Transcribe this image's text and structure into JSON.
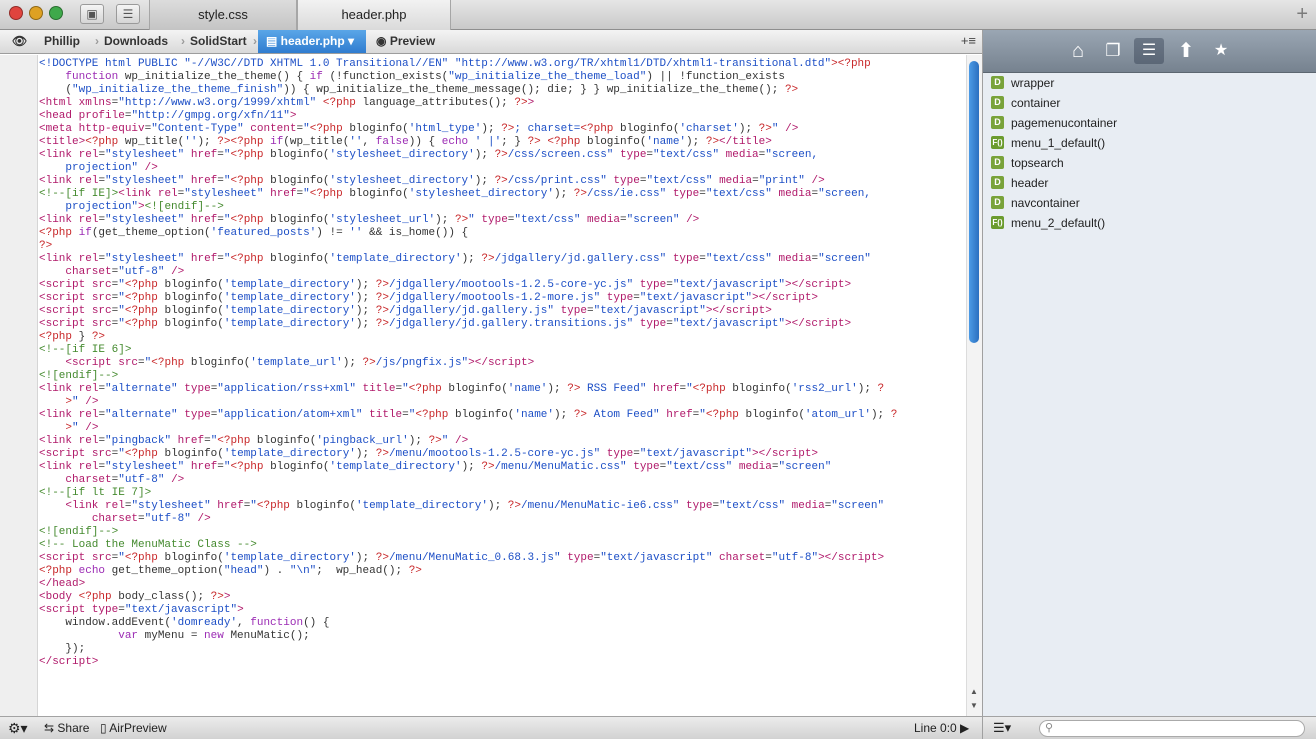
{
  "window": {
    "tabs": [
      {
        "label": "style.css",
        "active": false
      },
      {
        "label": "header.php",
        "active": true
      }
    ],
    "add_tab_label": "+"
  },
  "pathbar": {
    "breadcrumb": [
      "Phillip",
      "Downloads",
      "SolidStart",
      "header.php ▾"
    ],
    "preview_label": "Preview",
    "sidebar_toggle_label": "+≡"
  },
  "editor": {
    "lines": [
      {
        "n": "1",
        "html": "<span class=\"s\">&lt;!DOCTYPE html PUBLIC \"-//W3C//DTD XHTML 1.0 Transitional//EN\" \"http://www.w3.org/TR/xhtml1/DTD/xhtml1-transitional.dtd\"</span><span class=\"p\">&gt;&lt;?php</span>"
      },
      {
        "n": "",
        "html": "    <span class=\"k\">function</span> wp_initialize_the_theme() { <span class=\"k\">if</span> (!function_exists(<span class=\"s\">\"wp_initialize_the_theme_load\"</span>) || !function_exists"
      },
      {
        "n": "",
        "html": "    (<span class=\"s\">\"wp_initialize_the_theme_finish\"</span>)) { wp_initialize_the_theme_message(); die; } } wp_initialize_the_theme(); <span class=\"p\">?&gt;</span>"
      },
      {
        "n": "2",
        "html": "<span class=\"t\">&lt;html</span> <span class=\"a\">xmlns</span>=<span class=\"s\">\"http://www.w3.org/1999/xhtml\"</span> <span class=\"p\">&lt;?php</span> language_attributes(); <span class=\"p\">?&gt;</span><span class=\"t\">&gt;</span>"
      },
      {
        "n": "3",
        "html": ""
      },
      {
        "n": "4",
        "html": "<span class=\"t\">&lt;head</span> <span class=\"a\">profile</span>=<span class=\"s\">\"http://gmpg.org/xfn/11\"</span><span class=\"t\">&gt;</span>"
      },
      {
        "n": "5",
        "html": "<span class=\"t\">&lt;meta</span> <span class=\"a\">http-equiv</span>=<span class=\"s\">\"Content-Type\"</span> <span class=\"a\">content</span>=<span class=\"s\">\"</span><span class=\"p\">&lt;?php</span> bloginfo(<span class=\"s\">'html_type'</span>); <span class=\"p\">?&gt;</span><span class=\"s\">; charset=</span><span class=\"p\">&lt;?php</span> bloginfo(<span class=\"s\">'charset'</span>); <span class=\"p\">?&gt;</span><span class=\"s\">\"</span> <span class=\"t\">/&gt;</span>"
      },
      {
        "n": "6",
        "html": ""
      },
      {
        "n": "7",
        "html": "<span class=\"t\">&lt;title&gt;</span><span class=\"p\">&lt;?php</span> wp_title(<span class=\"s\">''</span>); <span class=\"p\">?&gt;&lt;?php</span> <span class=\"k\">if</span>(wp_title(<span class=\"s\">''</span>, <span class=\"k\">false</span>)) { <span class=\"k\">echo</span> <span class=\"s\">' |'</span>; } <span class=\"p\">?&gt;</span> <span class=\"p\">&lt;?php</span> bloginfo(<span class=\"s\">'name'</span>); <span class=\"p\">?&gt;</span><span class=\"t\">&lt;/title&gt;</span>"
      },
      {
        "n": "8",
        "html": "<span class=\"t\">&lt;link</span> <span class=\"a\">rel</span>=<span class=\"s\">\"stylesheet\"</span> <span class=\"a\">href</span>=<span class=\"s\">\"</span><span class=\"p\">&lt;?php</span> bloginfo(<span class=\"s\">'stylesheet_directory'</span>); <span class=\"p\">?&gt;</span><span class=\"s\">/css/screen.css\"</span> <span class=\"a\">type</span>=<span class=\"s\">\"text/css\"</span> <span class=\"a\">media</span>=<span class=\"s\">\"screen,</span>"
      },
      {
        "n": "",
        "html": "    <span class=\"s\">projection\"</span> <span class=\"t\">/&gt;</span>"
      },
      {
        "n": "9",
        "html": "<span class=\"t\">&lt;link</span> <span class=\"a\">rel</span>=<span class=\"s\">\"stylesheet\"</span> <span class=\"a\">href</span>=<span class=\"s\">\"</span><span class=\"p\">&lt;?php</span> bloginfo(<span class=\"s\">'stylesheet_directory'</span>); <span class=\"p\">?&gt;</span><span class=\"s\">/css/print.css\"</span> <span class=\"a\">type</span>=<span class=\"s\">\"text/css\"</span> <span class=\"a\">media</span>=<span class=\"s\">\"print\"</span> <span class=\"t\">/&gt;</span>"
      },
      {
        "n": "10",
        "html": "<span class=\"c\">&lt;!--[if IE]&gt;</span><span class=\"t\">&lt;link</span> <span class=\"a\">rel</span>=<span class=\"s\">\"stylesheet\"</span> <span class=\"a\">href</span>=<span class=\"s\">\"</span><span class=\"p\">&lt;?php</span> bloginfo(<span class=\"s\">'stylesheet_directory'</span>); <span class=\"p\">?&gt;</span><span class=\"s\">/css/ie.css\"</span> <span class=\"a\">type</span>=<span class=\"s\">\"text/css\"</span> <span class=\"a\">media</span>=<span class=\"s\">\"screen,</span>"
      },
      {
        "n": "",
        "html": "    <span class=\"s\">projection\"</span><span class=\"t\">&gt;</span><span class=\"c\">&lt;![endif]--&gt;</span>"
      },
      {
        "n": "11",
        "html": "<span class=\"t\">&lt;link</span> <span class=\"a\">rel</span>=<span class=\"s\">\"stylesheet\"</span> <span class=\"a\">href</span>=<span class=\"s\">\"</span><span class=\"p\">&lt;?php</span> bloginfo(<span class=\"s\">'stylesheet_url'</span>); <span class=\"p\">?&gt;</span><span class=\"s\">\"</span> <span class=\"a\">type</span>=<span class=\"s\">\"text/css\"</span> <span class=\"a\">media</span>=<span class=\"s\">\"screen\"</span> <span class=\"t\">/&gt;</span>"
      },
      {
        "n": "12",
        "html": "<span class=\"p\">&lt;?php</span> <span class=\"k\">if</span>(get_theme_option(<span class=\"s\">'featured_posts'</span>) != <span class=\"s\">''</span> &amp;&amp; is_home()) {"
      },
      {
        "n": "13",
        "html": "<span class=\"p\">?&gt;</span>"
      },
      {
        "n": "14",
        "html": "<span class=\"t\">&lt;link</span> <span class=\"a\">rel</span>=<span class=\"s\">\"stylesheet\"</span> <span class=\"a\">href</span>=<span class=\"s\">\"</span><span class=\"p\">&lt;?php</span> bloginfo(<span class=\"s\">'template_directory'</span>); <span class=\"p\">?&gt;</span><span class=\"s\">/jdgallery/jd.gallery.css\"</span> <span class=\"a\">type</span>=<span class=\"s\">\"text/css\"</span> <span class=\"a\">media</span>=<span class=\"s\">\"screen\"</span>"
      },
      {
        "n": "",
        "html": "    <span class=\"a\">charset</span>=<span class=\"s\">\"utf-8\"</span> <span class=\"t\">/&gt;</span>"
      },
      {
        "n": "15",
        "html": "<span class=\"t\">&lt;script</span> <span class=\"a\">src</span>=<span class=\"s\">\"</span><span class=\"p\">&lt;?php</span> bloginfo(<span class=\"s\">'template_directory'</span>); <span class=\"p\">?&gt;</span><span class=\"s\">/jdgallery/mootools-1.2.5-core-yc.js\"</span> <span class=\"a\">type</span>=<span class=\"s\">\"text/javascript\"</span><span class=\"t\">&gt;&lt;/script&gt;</span>"
      },
      {
        "n": "16",
        "html": "<span class=\"t\">&lt;script</span> <span class=\"a\">src</span>=<span class=\"s\">\"</span><span class=\"p\">&lt;?php</span> bloginfo(<span class=\"s\">'template_directory'</span>); <span class=\"p\">?&gt;</span><span class=\"s\">/jdgallery/mootools-1.2-more.js\"</span> <span class=\"a\">type</span>=<span class=\"s\">\"text/javascript\"</span><span class=\"t\">&gt;&lt;/script&gt;</span>"
      },
      {
        "n": "17",
        "html": "<span class=\"t\">&lt;script</span> <span class=\"a\">src</span>=<span class=\"s\">\"</span><span class=\"p\">&lt;?php</span> bloginfo(<span class=\"s\">'template_directory'</span>); <span class=\"p\">?&gt;</span><span class=\"s\">/jdgallery/jd.gallery.js\"</span> <span class=\"a\">type</span>=<span class=\"s\">\"text/javascript\"</span><span class=\"t\">&gt;&lt;/script&gt;</span>"
      },
      {
        "n": "18",
        "html": "<span class=\"t\">&lt;script</span> <span class=\"a\">src</span>=<span class=\"s\">\"</span><span class=\"p\">&lt;?php</span> bloginfo(<span class=\"s\">'template_directory'</span>); <span class=\"p\">?&gt;</span><span class=\"s\">/jdgallery/jd.gallery.transitions.js\"</span> <span class=\"a\">type</span>=<span class=\"s\">\"text/javascript\"</span><span class=\"t\">&gt;&lt;/script&gt;</span>"
      },
      {
        "n": "19",
        "html": "<span class=\"p\">&lt;?php</span> } <span class=\"p\">?&gt;</span>"
      },
      {
        "n": "20",
        "html": "<span class=\"c\">&lt;!--[if IE 6]&gt;</span>"
      },
      {
        "n": "21",
        "html": "    <span class=\"t\">&lt;script</span> <span class=\"a\">src</span>=<span class=\"s\">\"</span><span class=\"p\">&lt;?php</span> bloginfo(<span class=\"s\">'template_url'</span>); <span class=\"p\">?&gt;</span><span class=\"s\">/js/pngfix.js\"</span><span class=\"t\">&gt;&lt;/script&gt;</span>"
      },
      {
        "n": "22",
        "html": "<span class=\"c\">&lt;![endif]--&gt;</span>"
      },
      {
        "n": "23",
        "html": "<span class=\"t\">&lt;link</span> <span class=\"a\">rel</span>=<span class=\"s\">\"alternate\"</span> <span class=\"a\">type</span>=<span class=\"s\">\"application/rss+xml\"</span> <span class=\"a\">title</span>=<span class=\"s\">\"</span><span class=\"p\">&lt;?php</span> bloginfo(<span class=\"s\">'name'</span>); <span class=\"p\">?&gt;</span><span class=\"s\"> RSS Feed\"</span> <span class=\"a\">href</span>=<span class=\"s\">\"</span><span class=\"p\">&lt;?php</span> bloginfo(<span class=\"s\">'rss2_url'</span>); <span class=\"p\">?</span>"
      },
      {
        "n": "",
        "html": "    <span class=\"p\">&gt;</span><span class=\"s\">\"</span> <span class=\"t\">/&gt;</span>"
      },
      {
        "n": "24",
        "html": "<span class=\"t\">&lt;link</span> <span class=\"a\">rel</span>=<span class=\"s\">\"alternate\"</span> <span class=\"a\">type</span>=<span class=\"s\">\"application/atom+xml\"</span> <span class=\"a\">title</span>=<span class=\"s\">\"</span><span class=\"p\">&lt;?php</span> bloginfo(<span class=\"s\">'name'</span>); <span class=\"p\">?&gt;</span><span class=\"s\"> Atom Feed\"</span> <span class=\"a\">href</span>=<span class=\"s\">\"</span><span class=\"p\">&lt;?php</span> bloginfo(<span class=\"s\">'atom_url'</span>); <span class=\"p\">?</span>"
      },
      {
        "n": "",
        "html": "    <span class=\"p\">&gt;</span><span class=\"s\">\"</span> <span class=\"t\">/&gt;</span>"
      },
      {
        "n": "25",
        "html": "<span class=\"t\">&lt;link</span> <span class=\"a\">rel</span>=<span class=\"s\">\"pingback\"</span> <span class=\"a\">href</span>=<span class=\"s\">\"</span><span class=\"p\">&lt;?php</span> bloginfo(<span class=\"s\">'pingback_url'</span>); <span class=\"p\">?&gt;</span><span class=\"s\">\"</span> <span class=\"t\">/&gt;</span>"
      },
      {
        "n": "26",
        "html": ""
      },
      {
        "n": "27",
        "html": "<span class=\"t\">&lt;script</span> <span class=\"a\">src</span>=<span class=\"s\">\"</span><span class=\"p\">&lt;?php</span> bloginfo(<span class=\"s\">'template_directory'</span>); <span class=\"p\">?&gt;</span><span class=\"s\">/menu/mootools-1.2.5-core-yc.js\"</span> <span class=\"a\">type</span>=<span class=\"s\">\"text/javascript\"</span><span class=\"t\">&gt;&lt;/script&gt;</span>"
      },
      {
        "n": "28",
        "html": "<span class=\"t\">&lt;link</span> <span class=\"a\">rel</span>=<span class=\"s\">\"stylesheet\"</span> <span class=\"a\">href</span>=<span class=\"s\">\"</span><span class=\"p\">&lt;?php</span> bloginfo(<span class=\"s\">'template_directory'</span>); <span class=\"p\">?&gt;</span><span class=\"s\">/menu/MenuMatic.css\"</span> <span class=\"a\">type</span>=<span class=\"s\">\"text/css\"</span> <span class=\"a\">media</span>=<span class=\"s\">\"screen\"</span>"
      },
      {
        "n": "",
        "html": "    <span class=\"a\">charset</span>=<span class=\"s\">\"utf-8\"</span> <span class=\"t\">/&gt;</span>"
      },
      {
        "n": "29",
        "html": "<span class=\"c\">&lt;!--[if lt IE 7]&gt;</span>"
      },
      {
        "n": "30",
        "html": "    <span class=\"t\">&lt;link</span> <span class=\"a\">rel</span>=<span class=\"s\">\"stylesheet\"</span> <span class=\"a\">href</span>=<span class=\"s\">\"</span><span class=\"p\">&lt;?php</span> bloginfo(<span class=\"s\">'template_directory'</span>); <span class=\"p\">?&gt;</span><span class=\"s\">/menu/MenuMatic-ie6.css\"</span> <span class=\"a\">type</span>=<span class=\"s\">\"text/css\"</span> <span class=\"a\">media</span>=<span class=\"s\">\"screen\"</span>"
      },
      {
        "n": "",
        "html": "        <span class=\"a\">charset</span>=<span class=\"s\">\"utf-8\"</span> <span class=\"t\">/&gt;</span>"
      },
      {
        "n": "31",
        "html": "<span class=\"c\">&lt;![endif]--&gt;</span>"
      },
      {
        "n": "32",
        "html": "<span class=\"c\">&lt;!-- Load the MenuMatic Class --&gt;</span>"
      },
      {
        "n": "33",
        "html": "<span class=\"t\">&lt;script</span> <span class=\"a\">src</span>=<span class=\"s\">\"</span><span class=\"p\">&lt;?php</span> bloginfo(<span class=\"s\">'template_directory'</span>); <span class=\"p\">?&gt;</span><span class=\"s\">/menu/MenuMatic_0.68.3.js\"</span> <span class=\"a\">type</span>=<span class=\"s\">\"text/javascript\"</span> <span class=\"a\">charset</span>=<span class=\"s\">\"utf-8\"</span><span class=\"t\">&gt;&lt;/script&gt;</span>"
      },
      {
        "n": "34",
        "html": ""
      },
      {
        "n": "35",
        "html": "<span class=\"p\">&lt;?php</span> <span class=\"k\">echo</span> get_theme_option(<span class=\"s\">\"head\"</span>) . <span class=\"s\">\"\\n\"</span>;  wp_head(); <span class=\"p\">?&gt;</span>"
      },
      {
        "n": "36",
        "html": "<span class=\"t\">&lt;/head&gt;</span>"
      },
      {
        "n": "37",
        "html": "<span class=\"t\">&lt;body</span> <span class=\"p\">&lt;?php</span> body_class(); <span class=\"p\">?&gt;</span><span class=\"t\">&gt;</span>"
      },
      {
        "n": "38",
        "html": "<span class=\"t\">&lt;script</span> <span class=\"a\">type</span>=<span class=\"s\">\"text/javascript\"</span><span class=\"t\">&gt;</span>"
      },
      {
        "n": "39",
        "html": "    window.addEvent(<span class=\"s\">'domready'</span>, <span class=\"k\">function</span>() {"
      },
      {
        "n": "40",
        "html": "            <span class=\"k\">var</span> myMenu = <span class=\"k\">new</span> MenuMatic();"
      },
      {
        "n": "41",
        "html": "    });"
      },
      {
        "n": "42",
        "html": "<span class=\"t\">&lt;/script&gt;</span>"
      }
    ]
  },
  "symbols": [
    {
      "badge": "D",
      "label": "wrapper"
    },
    {
      "badge": "D",
      "label": "container"
    },
    {
      "badge": "D",
      "label": "pagemenucontainer"
    },
    {
      "badge": "F()",
      "label": "menu_1_default()"
    },
    {
      "badge": "D",
      "label": "topsearch"
    },
    {
      "badge": "D",
      "label": "header"
    },
    {
      "badge": "D",
      "label": "navcontainer"
    },
    {
      "badge": "F()",
      "label": "menu_2_default()"
    }
  ],
  "status": {
    "share_label": "Share",
    "airpreview_label": "AirPreview",
    "line_info": "Line 0:0"
  },
  "colors": {
    "accent": "#3a87d6",
    "string": "#1d4fc6",
    "php_tag": "#c8282a",
    "keyword": "#9b2bb4",
    "comment": "#448a2e"
  }
}
